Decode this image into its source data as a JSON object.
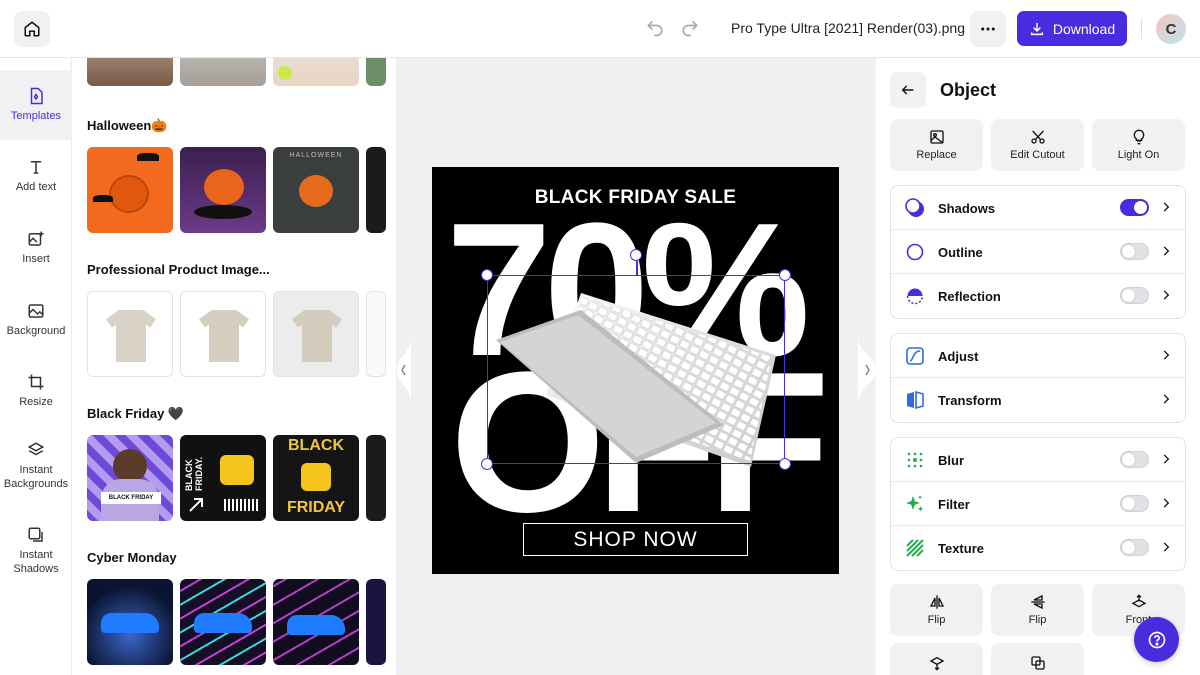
{
  "topbar": {
    "filename": "Pro Type Ultra [2021] Render(03).png",
    "download_label": "Download",
    "avatar_initial": "C",
    "accent": "#4b2be0"
  },
  "rail": {
    "items": [
      {
        "label": "Templates",
        "icon": "templates-icon",
        "active": true
      },
      {
        "label": "Add text",
        "icon": "text-icon"
      },
      {
        "label": "Insert",
        "icon": "insert-image-icon"
      },
      {
        "label": "Background",
        "icon": "background-icon"
      },
      {
        "label": "Resize",
        "icon": "crop-icon"
      },
      {
        "label": "Instant Backgrounds",
        "icon": "layers-icon"
      },
      {
        "label": "Instant Shadows",
        "icon": "shadow-icon"
      }
    ]
  },
  "templates": {
    "sections": [
      {
        "title": "Halloween🎃"
      },
      {
        "title": "Professional Product Image..."
      },
      {
        "title": "Black Friday 🖤"
      },
      {
        "title": "Cyber Monday"
      }
    ],
    "thumb_texts": {
      "halloween_3": "HALLOWEEN",
      "bf_1_badge": "BLACK FRIDAY",
      "bf_2_text": "BLACK FRIDAY.",
      "bf_3_top": "BLACK",
      "bf_3_bottom": "FRIDAY"
    }
  },
  "artboard": {
    "headline": "BLACK FRIDAY SALE",
    "big_top": "70%",
    "big_bottom": "OFF",
    "cta": "SHOP NOW"
  },
  "object_panel": {
    "title": "Object",
    "tools": [
      {
        "label": "Replace",
        "icon": "replace-image-icon"
      },
      {
        "label": "Edit Cutout",
        "icon": "scissors-icon"
      },
      {
        "label": "Light On",
        "icon": "lightbulb-icon"
      }
    ],
    "effects": [
      {
        "label": "Shadows",
        "icon": "shadows-icon",
        "toggle": true,
        "on": true
      },
      {
        "label": "Outline",
        "icon": "outline-icon",
        "toggle": true,
        "on": false
      },
      {
        "label": "Reflection",
        "icon": "reflection-icon",
        "toggle": true,
        "on": false
      }
    ],
    "adjustments": [
      {
        "label": "Adjust",
        "icon": "adjust-icon"
      },
      {
        "label": "Transform",
        "icon": "transform-icon"
      }
    ],
    "styles": [
      {
        "label": "Blur",
        "icon": "blur-icon",
        "toggle": true,
        "on": false
      },
      {
        "label": "Filter",
        "icon": "sparkle-icon",
        "toggle": true,
        "on": false
      },
      {
        "label": "Texture",
        "icon": "texture-icon",
        "toggle": true,
        "on": false
      }
    ],
    "arrange": [
      {
        "label": "Flip",
        "icon": "flip-horizontal-icon"
      },
      {
        "label": "Flip",
        "icon": "flip-vertical-icon"
      },
      {
        "label": "Front",
        "icon": "bring-front-icon"
      }
    ]
  }
}
